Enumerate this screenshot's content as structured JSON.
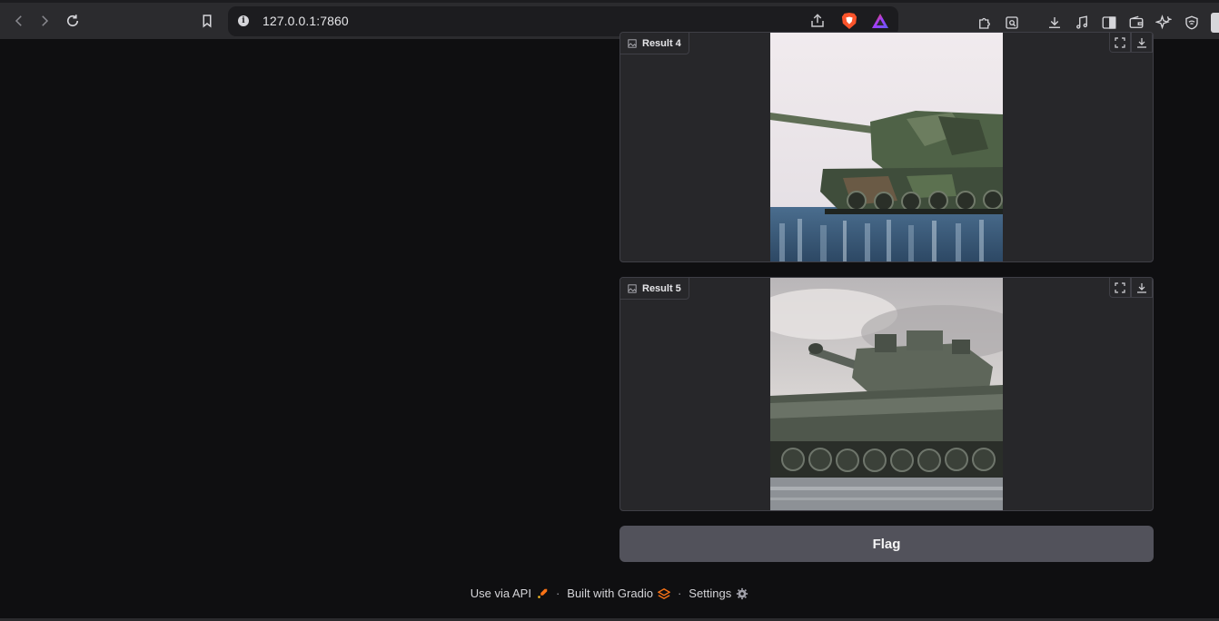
{
  "browser": {
    "url": "127.0.0.1:7860",
    "icons": [
      "back-icon",
      "forward-icon",
      "reload-icon",
      "bookmark-icon",
      "site-info-icon",
      "share-icon",
      "brave-shields-icon",
      "brave-rewards-icon",
      "extensions-icon",
      "reader-icon",
      "downloads-icon",
      "media-icon",
      "sidebar-icon",
      "wallet-icon",
      "leo-ai-icon",
      "vpn-icon"
    ]
  },
  "results": [
    {
      "label": "Result 4"
    },
    {
      "label": "Result 5"
    }
  ],
  "flag_label": "Flag",
  "footer": {
    "api_label": "Use via API",
    "built_label": "Built with Gradio",
    "settings_label": "Settings",
    "separator": "·"
  },
  "colors": {
    "accent_orange": "#f97316",
    "button_gray": "#52525b",
    "card_bg": "#27272a"
  }
}
